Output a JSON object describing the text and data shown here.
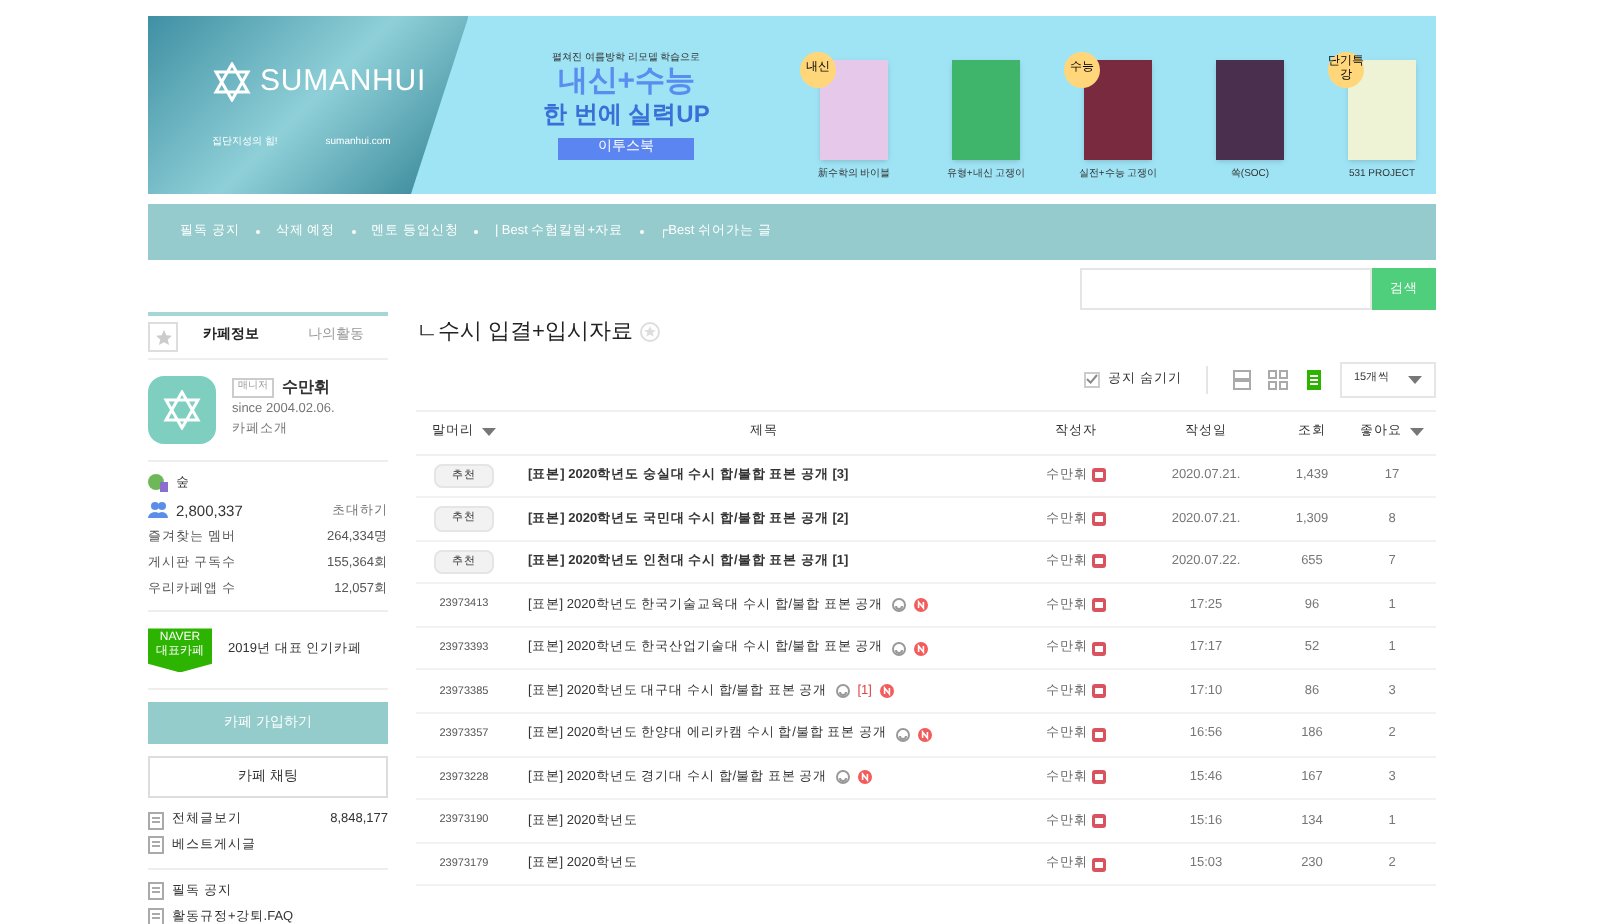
{
  "banner": {
    "logo": "SUMANHUI",
    "slogan": "집단지성의 힘!",
    "url": "sumanhui.com",
    "headline_top": "펼쳐진 여름방학 리모델 학습으로",
    "headline_1": "내신+수능",
    "headline_2": "한 번에 실력UP",
    "publisher": "이투스북",
    "books": [
      {
        "tag": "내신",
        "label": "新수학의 바이블",
        "color": "#e6c9ea"
      },
      {
        "label": "유형+내신 고쟁이",
        "color": "#3fb56b"
      },
      {
        "tag": "수능",
        "label": "실전+수능 고쟁이",
        "color": "#7a2a3f"
      },
      {
        "label": "쏙(SOC)",
        "color": "#4a2f4f"
      },
      {
        "tag": "단기특강",
        "label": "531 PROJECT",
        "color": "#eef3d6"
      }
    ]
  },
  "nav": [
    "필독 공지",
    "삭제 예정",
    "멘토 등업신청",
    "| Best 수험칼럼+자료",
    "┌Best 쉬어가는 글"
  ],
  "search": {
    "button": "검색"
  },
  "sidebar": {
    "tabs": [
      {
        "label": "카페정보",
        "selected": true
      },
      {
        "label": "나의활동",
        "selected": false
      }
    ],
    "manager_badge": "매니저",
    "cafe_name": "수만휘",
    "since": "since 2004.02.06.",
    "intro": "카페소개",
    "level": "숲",
    "members": "2,800,337",
    "invite": "초대하기",
    "stats": [
      {
        "label": "즐겨찾는 멤버",
        "value": "264,334명"
      },
      {
        "label": "게시판 구독수",
        "value": "155,364회"
      },
      {
        "label": "우리카페앱 수",
        "value": "12,057회"
      }
    ],
    "award_badge_1": "NAVER",
    "award_badge_2": "대표카페",
    "award": "2019년 대표 인기카페",
    "join": "카페 가입하기",
    "chat": "카페 채팅",
    "menu": [
      {
        "label": "전체글보기",
        "count": "8,848,177"
      },
      {
        "label": "베스트게시글"
      }
    ],
    "menu2": [
      {
        "label": "필독 공지"
      },
      {
        "label": "활동규정+강퇴.FAQ"
      }
    ]
  },
  "board": {
    "title": "ㄴ수시 입결+입시자료",
    "hide_notice": {
      "label": "공지 숨기기",
      "checked": true
    },
    "views": [
      {
        "selected": false
      },
      {
        "selected": false
      },
      {
        "selected": true
      }
    ],
    "per_page": "15개씩",
    "columns": [
      "말머리",
      "제목",
      "작성자",
      "작성일",
      "조회",
      "좋아요"
    ],
    "rows": [
      {
        "kind": "notice",
        "head": "추천",
        "title": "[표본] 2020학년도 숭실대 수시 합/불합 표본 공개 [3]",
        "emoticon": false,
        "new": false,
        "author": "수만휘",
        "date": "2020.07.21.",
        "views": "1,439",
        "likes": "17"
      },
      {
        "kind": "notice",
        "head": "추천",
        "title": "[표본] 2020학년도 국민대 수시 합/불합 표본 공개 [2]",
        "emoticon": false,
        "new": false,
        "author": "수만휘",
        "date": "2020.07.21.",
        "views": "1,309",
        "likes": "8"
      },
      {
        "kind": "notice",
        "head": "추천",
        "title": "[표본] 2020학년도 인천대 수시 합/불합 표본 공개 [1]",
        "emoticon": false,
        "new": false,
        "author": "수만휘",
        "date": "2020.07.22.",
        "views": "655",
        "likes": "7"
      },
      {
        "kind": "post",
        "head": "23973413",
        "title": "[표본] 2020학년도 한국기술교육대 수시 합/불합 표본 공개",
        "emoticon": true,
        "new": true,
        "author": "수만휘",
        "date": "17:25",
        "views": "96",
        "likes": "1"
      },
      {
        "kind": "post",
        "head": "23973393",
        "title": "[표본] 2020학년도 한국산업기술대 수시 합/불합 표본 공개",
        "emoticon": true,
        "new": true,
        "author": "수만휘",
        "date": "17:17",
        "views": "52",
        "likes": "1"
      },
      {
        "kind": "post",
        "head": "23973385",
        "title": "[표본] 2020학년도 대구대 수시 합/불합 표본 공개",
        "emoticon": true,
        "comments": "[1]",
        "new": true,
        "author": "수만휘",
        "date": "17:10",
        "views": "86",
        "likes": "3"
      },
      {
        "kind": "post",
        "head": "23973357",
        "title": "[표본] 2020학년도 한양대 에리카캠 수시 합/불합 표본 공개",
        "emoticon": true,
        "new": true,
        "author": "수만휘",
        "date": "16:56",
        "views": "186",
        "likes": "2"
      },
      {
        "kind": "post",
        "head": "23973228",
        "title": "[표본] 2020학년도 경기대 수시 합/불합 표본 공개",
        "emoticon": true,
        "new": true,
        "author": "수만휘",
        "date": "15:46",
        "views": "167",
        "likes": "3"
      },
      {
        "kind": "post",
        "head": "23973190",
        "title": "[표본] 2020학년도",
        "emoticon": false,
        "new": false,
        "author": "수만휘",
        "date": "15:16",
        "views": "134",
        "likes": "1"
      },
      {
        "kind": "post",
        "head": "23973179",
        "title": "[표본] 2020학년도",
        "emoticon": false,
        "new": false,
        "author": "수만휘",
        "date": "15:03",
        "views": "230",
        "likes": "2"
      }
    ]
  }
}
